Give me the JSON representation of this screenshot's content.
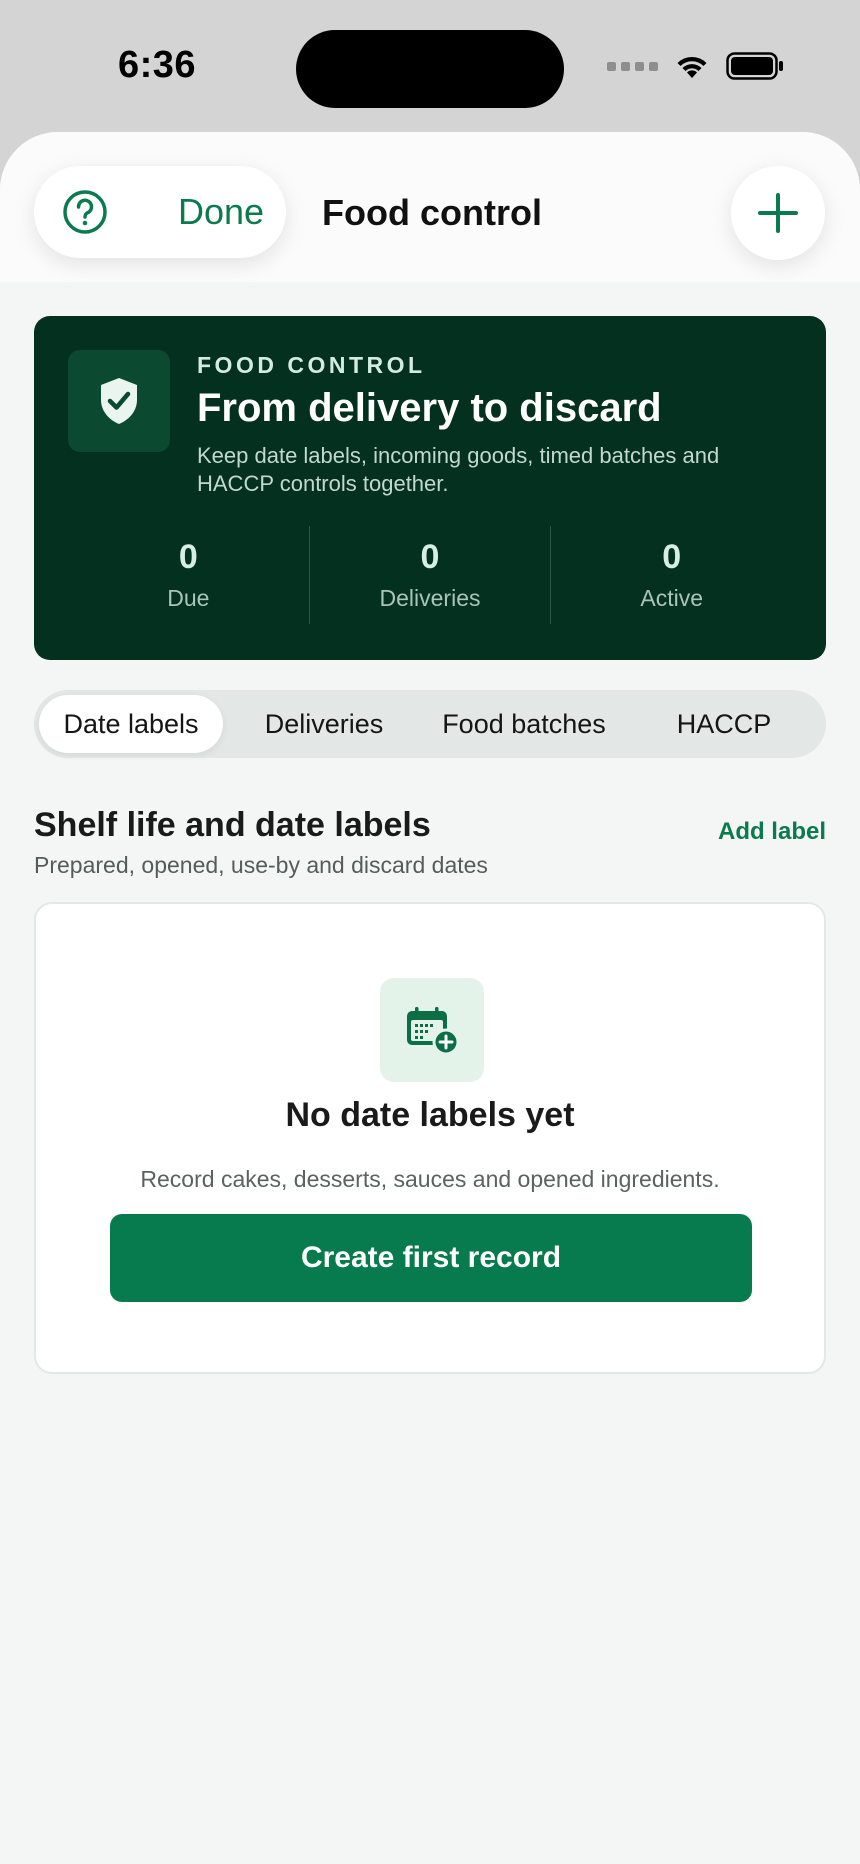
{
  "status_bar": {
    "time": "6:36",
    "icons": [
      "cellular-dots-icon",
      "wifi-icon",
      "battery-icon"
    ]
  },
  "header": {
    "help_icon": "question-circle-icon",
    "done_label": "Done",
    "title": "Food control",
    "add_icon": "plus-icon"
  },
  "hero": {
    "icon": "shield-check-icon",
    "eyebrow": "FOOD CONTROL",
    "title": "From delivery to discard",
    "description": "Keep date labels, incoming goods, timed batches and HACCP controls together.",
    "stats": [
      {
        "value": "0",
        "label": "Due"
      },
      {
        "value": "0",
        "label": "Deliveries"
      },
      {
        "value": "0",
        "label": "Active"
      }
    ]
  },
  "tabs": {
    "items": [
      {
        "label": "Date labels",
        "active": true
      },
      {
        "label": "Deliveries",
        "active": false
      },
      {
        "label": "Food batches",
        "active": false
      },
      {
        "label": "HACCP",
        "active": false
      }
    ]
  },
  "section": {
    "title": "Shelf life and date labels",
    "subtitle": "Prepared, opened, use-by and discard dates",
    "action_label": "Add label"
  },
  "empty_state": {
    "icon": "calendar-add-icon",
    "title": "No date labels yet",
    "description": "Record cakes, desserts, sauces and opened ingredients.",
    "button_label": "Create first record"
  },
  "colors": {
    "accent": "#077a4e",
    "hero_bg": "#04301f",
    "sheet_bg": "#f3f6f5",
    "tab_track": "#e3e8e6"
  }
}
